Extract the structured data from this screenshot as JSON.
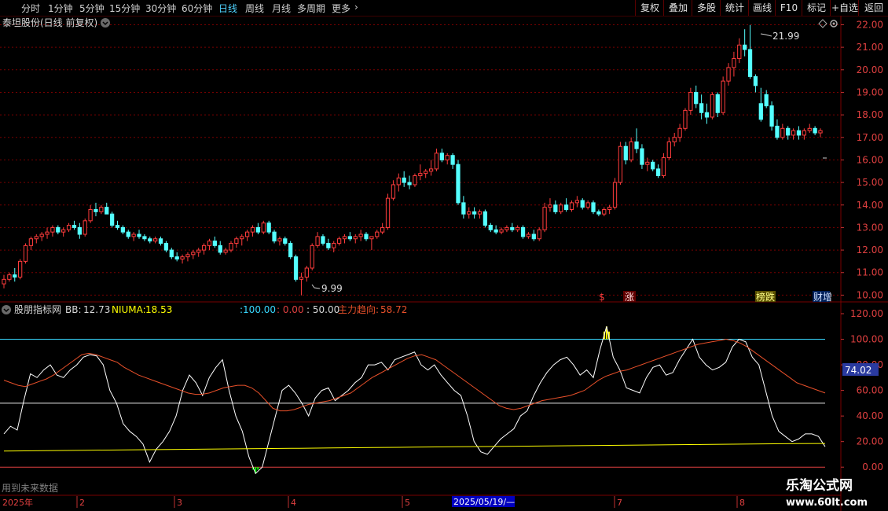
{
  "toolbar": {
    "periods": [
      "分时",
      "1分钟",
      "5分钟",
      "15分钟",
      "30分钟",
      "60分钟",
      "日线",
      "周线",
      "月线",
      "多周期",
      "更多"
    ],
    "active_period": "日线",
    "buttons": [
      "复权",
      "叠加",
      "多股",
      "统计",
      "画线",
      "F10",
      "标记",
      "+自选",
      "返回"
    ]
  },
  "stock": {
    "title": "泰坦股份(日线 前复权)",
    "high_label": "21.99",
    "low_label": "9.99"
  },
  "events": {
    "s": "$",
    "zhang": "涨",
    "bang": "榜跌",
    "cai": "财增"
  },
  "indicator": {
    "name": "股朋指标网",
    "bb_label": "BB:",
    "bb": "12.73",
    "niuma_label": "NIUMA:",
    "niuma": "18.53",
    "l100": ":100.00",
    "l0": ": 0.00",
    "l50": ": 50.00",
    "trend_label": "主力趋向:",
    "trend": "58.72",
    "current_value_badge": "74.02"
  },
  "footer": {
    "note": "用到未来数据",
    "year": "2025年",
    "months": [
      "2",
      "3",
      "4",
      "5",
      "7",
      "8"
    ],
    "cursor_date": "2025/05/19/—",
    "watermark_title": "乐淘公式网",
    "watermark_url": "www.60lt.com"
  },
  "colors": {
    "up": "#ff3c3c",
    "down": "#54ffff",
    "white_line": "#ffffff",
    "trend": "#e8502a",
    "yellow": "#ffff00",
    "cyan_line": "#38d8ff",
    "green_bar": "#00ff00",
    "grid": "#7a0000"
  },
  "chart_data": [
    {
      "type": "candlestick",
      "y_ticks": [
        "22.00",
        "21.00",
        "20.00",
        "19.00",
        "18.00",
        "17.00",
        "16.00",
        "15.00",
        "14.00",
        "13.00",
        "12.00",
        "11.00",
        "10.00"
      ],
      "ylim": [
        9.7,
        22.4
      ],
      "grid": true,
      "candles": [
        [
          10.5,
          10.9,
          10.3,
          10.7
        ],
        [
          10.7,
          11.0,
          10.6,
          10.9
        ],
        [
          10.9,
          11.2,
          10.6,
          10.8
        ],
        [
          10.8,
          11.6,
          10.7,
          11.5
        ],
        [
          11.5,
          12.3,
          11.4,
          12.2
        ],
        [
          12.2,
          12.6,
          12.0,
          12.5
        ],
        [
          12.5,
          12.7,
          12.3,
          12.6
        ],
        [
          12.6,
          12.8,
          12.4,
          12.7
        ],
        [
          12.7,
          13.0,
          12.5,
          12.8
        ],
        [
          12.8,
          13.1,
          12.6,
          13.0
        ],
        [
          13.0,
          13.1,
          12.7,
          12.8
        ],
        [
          12.8,
          13.0,
          12.6,
          12.9
        ],
        [
          12.9,
          13.2,
          12.8,
          13.1
        ],
        [
          13.1,
          13.3,
          12.9,
          13.0
        ],
        [
          13.0,
          13.2,
          12.5,
          12.7
        ],
        [
          12.7,
          13.4,
          12.6,
          13.3
        ],
        [
          13.3,
          14.0,
          13.2,
          13.8
        ],
        [
          13.8,
          14.1,
          13.5,
          13.7
        ],
        [
          13.7,
          14.0,
          13.6,
          13.9
        ],
        [
          13.9,
          14.1,
          13.6,
          13.6
        ],
        [
          13.6,
          13.7,
          13.0,
          13.1
        ],
        [
          13.1,
          13.3,
          12.9,
          13.0
        ],
        [
          13.0,
          13.1,
          12.7,
          12.8
        ],
        [
          12.8,
          12.9,
          12.5,
          12.6
        ],
        [
          12.6,
          12.8,
          12.4,
          12.7
        ],
        [
          12.7,
          12.9,
          12.5,
          12.6
        ],
        [
          12.6,
          12.7,
          12.4,
          12.5
        ],
        [
          12.5,
          12.6,
          12.3,
          12.4
        ],
        [
          12.4,
          12.6,
          12.3,
          12.5
        ],
        [
          12.5,
          12.6,
          12.2,
          12.3
        ],
        [
          12.3,
          12.4,
          11.9,
          12.0
        ],
        [
          12.0,
          12.1,
          11.6,
          11.7
        ],
        [
          11.7,
          11.9,
          11.5,
          11.6
        ],
        [
          11.6,
          11.8,
          11.4,
          11.7
        ],
        [
          11.7,
          11.9,
          11.5,
          11.8
        ],
        [
          11.8,
          12.0,
          11.6,
          11.9
        ],
        [
          11.9,
          12.1,
          11.7,
          12.0
        ],
        [
          12.0,
          12.3,
          11.8,
          12.2
        ],
        [
          12.2,
          12.5,
          12.0,
          12.4
        ],
        [
          12.4,
          12.6,
          12.1,
          12.2
        ],
        [
          12.2,
          12.4,
          11.8,
          11.9
        ],
        [
          11.9,
          12.1,
          11.8,
          12.0
        ],
        [
          12.0,
          12.4,
          11.9,
          12.3
        ],
        [
          12.3,
          12.6,
          12.1,
          12.5
        ],
        [
          12.5,
          12.7,
          12.2,
          12.6
        ],
        [
          12.6,
          12.9,
          12.4,
          12.8
        ],
        [
          12.8,
          13.1,
          12.6,
          13.0
        ],
        [
          13.0,
          13.2,
          12.7,
          12.8
        ],
        [
          12.8,
          13.3,
          12.7,
          13.2
        ],
        [
          13.2,
          13.3,
          12.7,
          12.8
        ],
        [
          12.8,
          12.9,
          12.3,
          12.4
        ],
        [
          12.4,
          12.6,
          12.2,
          12.5
        ],
        [
          12.5,
          12.6,
          12.2,
          12.3
        ],
        [
          12.3,
          12.4,
          11.6,
          11.7
        ],
        [
          11.7,
          11.8,
          10.6,
          10.7
        ],
        [
          10.7,
          11.0,
          9.99,
          10.8
        ],
        [
          10.8,
          11.3,
          10.6,
          11.2
        ],
        [
          11.2,
          12.3,
          11.1,
          12.2
        ],
        [
          12.2,
          12.8,
          12.1,
          12.6
        ],
        [
          12.6,
          12.7,
          12.2,
          12.3
        ],
        [
          12.3,
          12.5,
          12.0,
          12.1
        ],
        [
          12.1,
          12.4,
          11.9,
          12.3
        ],
        [
          12.3,
          12.6,
          12.2,
          12.5
        ],
        [
          12.5,
          12.7,
          12.3,
          12.6
        ],
        [
          12.6,
          12.8,
          12.4,
          12.5
        ],
        [
          12.5,
          12.7,
          12.3,
          12.6
        ],
        [
          12.6,
          12.9,
          12.4,
          12.7
        ],
        [
          12.7,
          12.8,
          12.4,
          12.5
        ],
        [
          12.5,
          12.6,
          12.0,
          12.6
        ],
        [
          12.6,
          12.9,
          12.5,
          12.8
        ],
        [
          12.8,
          13.2,
          12.7,
          13.0
        ],
        [
          13.0,
          14.5,
          12.9,
          14.3
        ],
        [
          14.3,
          15.1,
          14.2,
          14.9
        ],
        [
          14.9,
          15.4,
          14.6,
          15.2
        ],
        [
          15.2,
          15.5,
          14.8,
          15.0
        ],
        [
          15.0,
          15.3,
          14.7,
          14.9
        ],
        [
          14.9,
          15.4,
          14.8,
          15.3
        ],
        [
          15.3,
          15.8,
          15.1,
          15.4
        ],
        [
          15.4,
          15.6,
          15.2,
          15.5
        ],
        [
          15.5,
          16.0,
          15.3,
          15.6
        ],
        [
          15.6,
          16.5,
          15.5,
          16.3
        ],
        [
          16.3,
          16.5,
          15.9,
          16.0
        ],
        [
          16.0,
          16.3,
          15.8,
          16.2
        ],
        [
          16.2,
          16.3,
          15.6,
          15.8
        ],
        [
          15.8,
          16.0,
          14.0,
          14.1
        ],
        [
          14.1,
          14.4,
          13.4,
          13.6
        ],
        [
          13.6,
          13.9,
          13.4,
          13.7
        ],
        [
          13.7,
          13.9,
          13.4,
          13.6
        ],
        [
          13.6,
          13.8,
          13.4,
          13.7
        ],
        [
          13.7,
          13.8,
          13.0,
          13.1
        ],
        [
          13.1,
          13.2,
          12.8,
          12.9
        ],
        [
          12.9,
          13.1,
          12.7,
          12.8
        ],
        [
          12.8,
          13.0,
          12.7,
          12.9
        ],
        [
          12.9,
          13.1,
          12.8,
          13.0
        ],
        [
          13.0,
          13.2,
          12.8,
          12.9
        ],
        [
          12.9,
          13.1,
          12.8,
          13.0
        ],
        [
          13.0,
          13.1,
          12.5,
          12.6
        ],
        [
          12.6,
          12.8,
          12.5,
          12.7
        ],
        [
          12.7,
          12.9,
          12.4,
          12.5
        ],
        [
          12.5,
          13.0,
          12.4,
          12.9
        ],
        [
          12.9,
          14.1,
          12.8,
          13.9
        ],
        [
          13.9,
          14.3,
          13.7,
          14.0
        ],
        [
          14.0,
          14.2,
          13.6,
          13.7
        ],
        [
          13.7,
          14.1,
          13.6,
          14.0
        ],
        [
          14.0,
          14.3,
          13.7,
          13.8
        ],
        [
          13.8,
          14.2,
          13.7,
          14.1
        ],
        [
          14.1,
          14.4,
          13.9,
          14.2
        ],
        [
          14.2,
          14.3,
          13.8,
          13.9
        ],
        [
          13.9,
          14.2,
          13.8,
          14.1
        ],
        [
          14.1,
          14.2,
          13.6,
          13.7
        ],
        [
          13.7,
          13.8,
          13.5,
          13.6
        ],
        [
          13.6,
          13.9,
          13.5,
          13.8
        ],
        [
          13.8,
          14.0,
          13.6,
          13.9
        ],
        [
          13.9,
          15.2,
          13.8,
          15.0
        ],
        [
          15.0,
          16.8,
          14.9,
          16.6
        ],
        [
          16.6,
          16.8,
          15.8,
          16.0
        ],
        [
          16.0,
          17.0,
          15.9,
          16.8
        ],
        [
          16.8,
          17.4,
          16.3,
          16.5
        ],
        [
          16.5,
          16.7,
          15.6,
          15.8
        ],
        [
          15.8,
          16.1,
          15.5,
          15.9
        ],
        [
          15.9,
          16.0,
          15.5,
          15.6
        ],
        [
          15.6,
          15.8,
          15.2,
          15.3
        ],
        [
          15.3,
          16.3,
          15.2,
          16.1
        ],
        [
          16.1,
          17.0,
          16.0,
          16.8
        ],
        [
          16.8,
          17.2,
          16.6,
          17.0
        ],
        [
          17.0,
          17.6,
          16.8,
          17.4
        ],
        [
          17.4,
          18.3,
          17.3,
          18.2
        ],
        [
          18.2,
          19.2,
          18.0,
          19.0
        ],
        [
          19.0,
          19.3,
          18.3,
          18.5
        ],
        [
          18.5,
          18.9,
          17.8,
          18.1
        ],
        [
          18.1,
          18.5,
          17.6,
          17.9
        ],
        [
          17.9,
          19.0,
          17.8,
          18.9
        ],
        [
          18.9,
          19.0,
          17.9,
          18.1
        ],
        [
          18.1,
          19.7,
          18.0,
          19.5
        ],
        [
          19.5,
          20.3,
          19.3,
          20.1
        ],
        [
          20.1,
          20.8,
          19.7,
          20.5
        ],
        [
          20.5,
          21.4,
          20.3,
          21.1
        ],
        [
          21.1,
          21.8,
          20.6,
          20.9
        ],
        [
          20.9,
          21.99,
          19.6,
          19.7
        ],
        [
          19.7,
          19.8,
          19.0,
          19.3
        ],
        [
          18.5,
          19.2,
          17.7,
          17.8
        ],
        [
          18.9,
          19.1,
          18.3,
          18.4
        ],
        [
          18.4,
          18.6,
          17.3,
          17.5
        ],
        [
          17.5,
          17.8,
          16.9,
          17.0
        ],
        [
          17.0,
          17.6,
          16.9,
          17.4
        ],
        [
          17.4,
          17.5,
          16.9,
          17.1
        ],
        [
          17.1,
          17.4,
          16.9,
          17.3
        ],
        [
          17.3,
          17.5,
          16.9,
          17.1
        ],
        [
          17.1,
          17.4,
          16.9,
          17.3
        ],
        [
          17.3,
          17.6,
          17.2,
          17.4
        ],
        [
          17.4,
          17.5,
          17.1,
          17.2
        ],
        [
          17.2,
          17.4,
          17.0,
          17.3
        ]
      ]
    },
    {
      "type": "line",
      "y_ticks": [
        "120.00",
        "100.00",
        "80.00",
        "60.00",
        "40.00",
        "20.00",
        "0.00"
      ],
      "ylim": [
        -22,
        128
      ],
      "series": [
        {
          "color": "#ffffff",
          "values": [
            26,
            32,
            29,
            52,
            73,
            70,
            76,
            80,
            72,
            70,
            76,
            80,
            86,
            88,
            87,
            80,
            60,
            50,
            34,
            28,
            24,
            18,
            4,
            14,
            20,
            28,
            40,
            60,
            72,
            66,
            56,
            70,
            78,
            84,
            60,
            40,
            28,
            8,
            -5,
            0,
            20,
            40,
            60,
            64,
            58,
            50,
            40,
            54,
            60,
            62,
            52,
            56,
            60,
            66,
            70,
            80,
            80,
            82,
            76,
            84,
            86,
            88,
            90,
            80,
            76,
            80,
            72,
            66,
            60,
            56,
            40,
            20,
            12,
            10,
            16,
            22,
            26,
            30,
            40,
            44,
            56,
            66,
            74,
            80,
            84,
            86,
            80,
            72,
            76,
            70,
            92,
            110,
            86,
            76,
            62,
            60,
            58,
            70,
            78,
            80,
            72,
            74,
            84,
            92,
            100,
            86,
            80,
            76,
            78,
            82,
            94,
            100,
            98,
            86,
            80,
            60,
            40,
            28,
            24,
            20,
            22,
            26,
            26,
            24,
            16
          ]
        },
        {
          "color": "#e8502a",
          "values": [
            68,
            66,
            64,
            63,
            65,
            67,
            69,
            72,
            76,
            80,
            84,
            88,
            89,
            88,
            86,
            84,
            82,
            78,
            75,
            72,
            70,
            68,
            66,
            64,
            62,
            60,
            58,
            57,
            57,
            58,
            60,
            62,
            63,
            64,
            64,
            62,
            58,
            52,
            46,
            44,
            44,
            45,
            47,
            49,
            50,
            51,
            52,
            54,
            56,
            58,
            62,
            66,
            70,
            73,
            76,
            79,
            82,
            85,
            87,
            88,
            86,
            84,
            80,
            76,
            72,
            68,
            64,
            60,
            56,
            52,
            48,
            46,
            45,
            46,
            48,
            50,
            52,
            53,
            54,
            55,
            56,
            58,
            60,
            64,
            68,
            71,
            73,
            75,
            76,
            78,
            80,
            82,
            84,
            86,
            88,
            90,
            92,
            94,
            96,
            97,
            98,
            99,
            100,
            99,
            97,
            94,
            90,
            86,
            82,
            78,
            74,
            70,
            66,
            64,
            62,
            60,
            58
          ]
        },
        {
          "color": "#ffff00",
          "values": [
            12.6,
            12.9,
            13.2,
            13.5,
            13.8,
            14.1,
            14.4,
            14.7,
            15.0,
            15.3,
            15.6,
            15.9,
            16.2,
            16.5,
            16.8,
            17.1,
            17.4,
            17.7,
            18.0,
            18.3,
            18.5
          ]
        }
      ]
    }
  ]
}
